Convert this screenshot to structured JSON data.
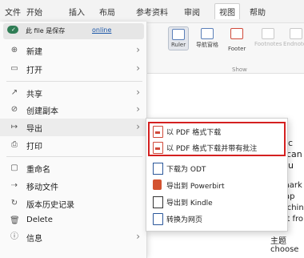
{
  "tabs": [
    "文件",
    "开始",
    "插入",
    "布局",
    "参考资料",
    "审阅",
    "视图",
    "帮助"
  ],
  "ribbon": {
    "buttons": [
      "Ruler",
      "导航窗格",
      "Footer",
      "Footnotes",
      "Endnotes"
    ],
    "group_label": "Show"
  },
  "file_menu": {
    "save_text": "此 file 是保存",
    "save_status": "online",
    "items": [
      {
        "label": "新建",
        "icon": "new-icon",
        "glyph": "⊕",
        "has_submenu": true
      },
      {
        "label": "打开",
        "icon": "open-folder-icon",
        "glyph": "▭",
        "has_submenu": true
      },
      {
        "label": "共享",
        "icon": "share-icon",
        "glyph": "↗",
        "has_submenu": true
      },
      {
        "label": "创建副本",
        "icon": "copy-icon",
        "glyph": "⊘",
        "has_submenu": true
      },
      {
        "label": "导出",
        "icon": "export-icon",
        "glyph": "↦",
        "has_submenu": true
      },
      {
        "label": "打印",
        "icon": "print-icon",
        "glyph": "⎙",
        "has_submenu": false
      },
      {
        "label": "重命名",
        "icon": "rename-icon",
        "glyph": "▢",
        "has_submenu": false
      },
      {
        "label": "移动文件",
        "icon": "move-file-icon",
        "glyph": "⇢",
        "has_submenu": false
      },
      {
        "label": "版本历史记录",
        "icon": "version-history-icon",
        "glyph": "↻",
        "has_submenu": false
      },
      {
        "label": "Delete",
        "icon": "trash-icon",
        "glyph": "🗑",
        "has_submenu": false
      },
      {
        "label": "信息",
        "icon": "info-icon",
        "glyph": "ⓘ",
        "has_submenu": true
      }
    ]
  },
  "export_submenu": {
    "items": [
      {
        "label": "以 PDF 格式下载",
        "icon": "pdf-icon"
      },
      {
        "label": "以 PDF 格式下载并带有批注",
        "icon": "pdf-comments-icon"
      },
      {
        "label": "下载为 ODT",
        "icon": "odt-icon"
      },
      {
        "label": "导出到 Powerbirt",
        "icon": "powerpoint-icon"
      },
      {
        "label": "导出到 Kindle",
        "icon": "kindle-icon"
      },
      {
        "label": "转换为网页",
        "icon": "webpage-icon"
      }
    ]
  },
  "document": {
    "lines": [
      "'",
      "c",
      "can",
      "u",
      "mark",
      "ap",
      "itchin",
      "nt fro",
      "主题",
      "choose"
    ]
  },
  "colors": {
    "highlight_box": "#d42020",
    "link": "#1a56a8",
    "cloud": "#2f7d55"
  }
}
